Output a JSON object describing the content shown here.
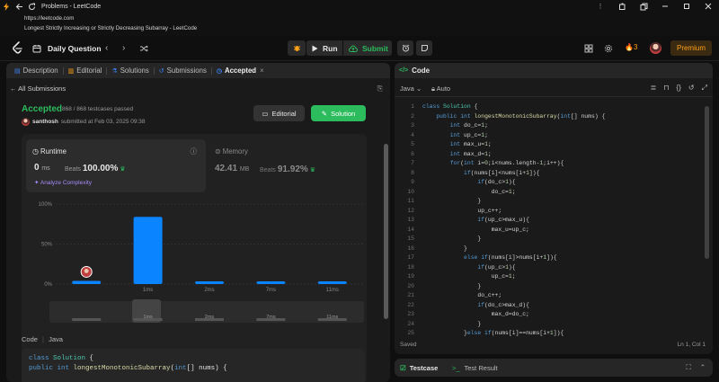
{
  "browser": {
    "tab_title": "Problems - LeetCode",
    "url": "https://leetcode.com",
    "page_title": "Longest Strictly Increasing or Strictly Decreasing Subarray - LeetCode"
  },
  "nav": {
    "title": "Daily Question",
    "run_label": "Run",
    "submit_label": "Submit",
    "streak": "3",
    "premium_label": "Premium"
  },
  "left": {
    "tabs": [
      {
        "label": "Description",
        "icon": "description-icon"
      },
      {
        "label": "Editorial",
        "icon": "book-icon"
      },
      {
        "label": "Solutions",
        "icon": "flask-icon"
      },
      {
        "label": "Submissions",
        "icon": "history-icon"
      },
      {
        "label": "Accepted",
        "icon": "clock-icon"
      }
    ],
    "all_submissions": "All Submissions",
    "status": "Accepted",
    "passed": "868 / 868 testcases passed",
    "author": "santhosh",
    "submitted_at": "submitted at Feb 03, 2025 09:38",
    "editorial_button": "Editorial",
    "solution_button": "Solution",
    "runtime": {
      "label": "Runtime",
      "value": "0",
      "unit": "ms",
      "beats_label": "Beats",
      "beats": "100.00%",
      "analyze": "Analyze Complexity"
    },
    "memory": {
      "label": "Memory",
      "value": "42.41",
      "unit": "MB",
      "beats_label": "Beats",
      "beats": "91.92%"
    },
    "code_label": "Code",
    "code_lang": "Java",
    "code_preview": [
      "class Solution {",
      "    public int longestMonotonicSubarray(int[] nums) {"
    ]
  },
  "chart_data": {
    "type": "bar",
    "categories": [
      "0ms",
      "1ms",
      "2ms",
      "7ms",
      "11ms"
    ],
    "values": [
      4,
      84,
      3,
      3,
      3
    ],
    "ylim": [
      0,
      100
    ],
    "yticks": [
      "0%",
      "50%",
      "100%"
    ],
    "highlight_index": 0,
    "bar_color": "#0a84ff"
  },
  "right": {
    "title": "Code",
    "language": "Java",
    "mode": "Auto",
    "status_left": "Saved",
    "status_right": "Ln 1, Col 1",
    "code_lines": [
      "class Solution {",
      "    public int longestMonotonicSubarray(int[] nums) {",
      "        int do_c=1;",
      "        int up_c=1;",
      "        int max_u=1;",
      "        int max_d=1;",
      "        for(int i=0;i<nums.length-1;i++){",
      "            if(nums[i]<nums[i+1]){",
      "                if(do_c>1){",
      "                    do_c=1;",
      "                }",
      "                up_c++;",
      "                if(up_c>max_u){",
      "                    max_u=up_c;",
      "                }",
      "            }",
      "            else if(nums[i]>nums[i+1]){",
      "                if(up_c>1){",
      "                    up_c=1;",
      "                }",
      "                do_c++;",
      "                if(do_c>max_d){",
      "                    max_d=do_c;",
      "                }",
      "            }else if(nums[i]==nums[i+1]){"
    ]
  },
  "bottom": {
    "testcase": "Testcase",
    "test_result": "Test Result"
  },
  "colors": {
    "accent_green": "#2cbb5d",
    "accent_orange": "#ffa116",
    "bar_blue": "#0a84ff"
  }
}
